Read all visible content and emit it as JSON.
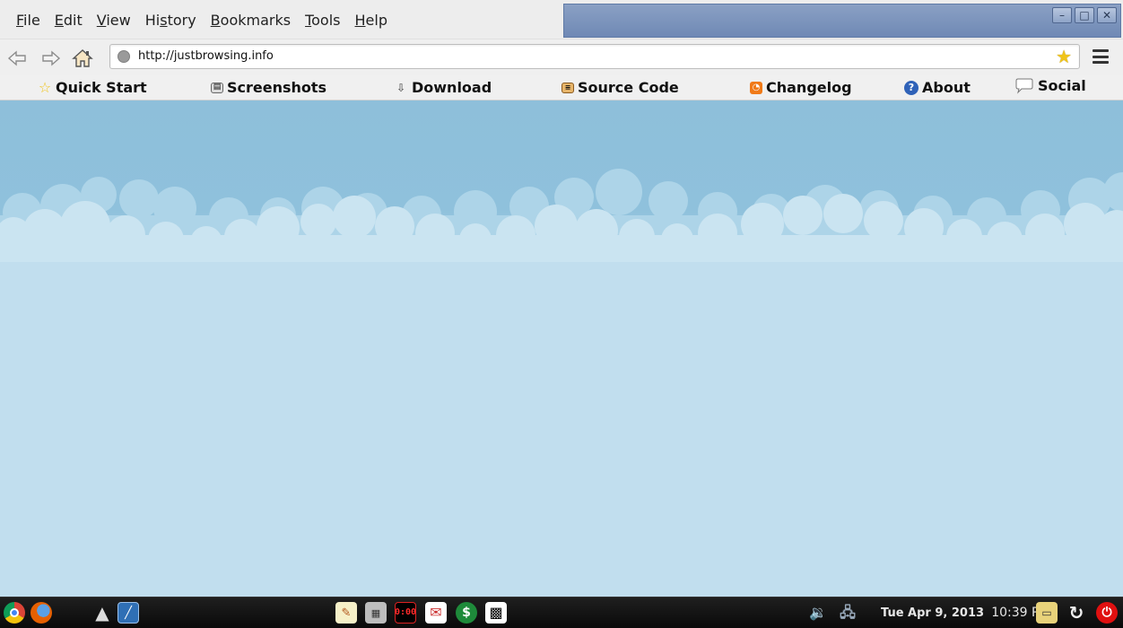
{
  "menu": {
    "items": [
      {
        "accel": "F",
        "rest": "ile"
      },
      {
        "accel": "E",
        "rest": "dit"
      },
      {
        "accel": "V",
        "rest": "iew"
      },
      {
        "pre": "Hi",
        "accel": "s",
        "rest": "tory"
      },
      {
        "accel": "B",
        "rest": "ookmarks"
      },
      {
        "accel": "T",
        "rest": "ools"
      },
      {
        "accel": "H",
        "rest": "elp"
      }
    ]
  },
  "window_buttons": {
    "minimize": "–",
    "maximize": "□",
    "close": "✕"
  },
  "nav": {
    "back_icon": "back-arrow",
    "forward_icon": "forward-arrow",
    "home_icon": "home"
  },
  "urlbar": {
    "url": "http://justbrowsing.info",
    "star_icon": "bookmark-star"
  },
  "links": [
    {
      "label": "Quick Start",
      "icon": "star"
    },
    {
      "label": "Screenshots",
      "icon": "screenshots"
    },
    {
      "label": "Download",
      "icon": "download"
    },
    {
      "label": "Source Code",
      "icon": "source-code"
    },
    {
      "label": "Changelog",
      "icon": "rss"
    },
    {
      "label": "About",
      "icon": "about"
    },
    {
      "label": "Social",
      "icon": "speech-bubble"
    }
  ],
  "colors": {
    "sky_top": "#8ebfda",
    "sky_bottom": "#c1deee",
    "cloud": "#cfe6f2",
    "titlebar": "#7f97be"
  },
  "taskbar": {
    "apps": [
      "chrome",
      "firefox",
      "arch",
      "draw"
    ],
    "tools": [
      "text-editor",
      "calculator",
      "clock-timer",
      "mail",
      "dollar",
      "qr-code"
    ],
    "tray": [
      "volume",
      "network"
    ],
    "date": "Tue Apr 9, 2013",
    "time": "10:39 PM",
    "timer_text": "0:00",
    "end_icons": [
      "display",
      "refresh",
      "power"
    ]
  }
}
